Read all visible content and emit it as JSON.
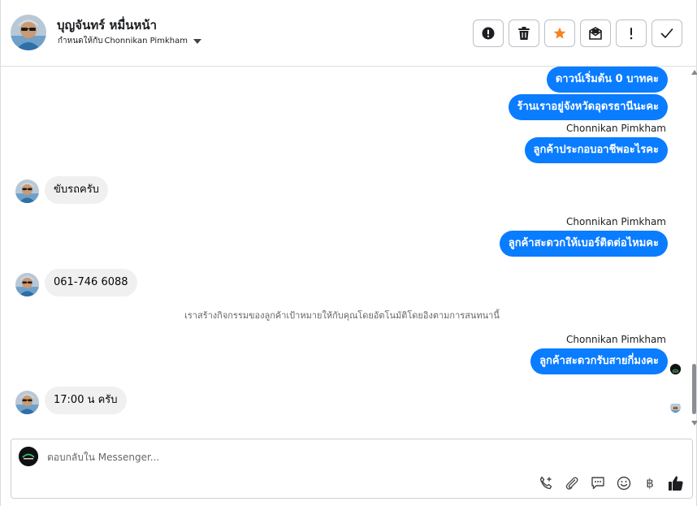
{
  "header": {
    "contact_name": "บุญจันทร์ หมื่นหน้า",
    "assigned_label": "กำหนดให้กับ",
    "assigned_to": "Chonnikan Pimkham",
    "action_icons": [
      "alert-circle-icon",
      "trash-icon",
      "star-icon",
      "mail-mark-icon",
      "exclamation-icon",
      "check-icon"
    ],
    "star_color": "#f5831f"
  },
  "messages": [
    {
      "direction": "out",
      "text": "ดาวน์เริ่มต้น 0 บาทคะ"
    },
    {
      "direction": "out",
      "text": "ร้านเราอยู่จังหวัดอุดรธานีนะคะ"
    },
    {
      "direction": "out",
      "sender": "Chonnikan Pimkham",
      "text": "ลูกค้าประกอบอาชีพอะไรคะ"
    },
    {
      "direction": "in",
      "text": "ขับรถครับ"
    },
    {
      "direction": "out",
      "sender": "Chonnikan Pimkham",
      "text": "ลูกค้าสะดวกให้เบอร์ติดต่อไหมคะ"
    },
    {
      "direction": "in",
      "text": "061-746 6088"
    },
    {
      "direction": "system",
      "text": "เราสร้างกิจกรรมของลูกค้าเป้าหมายให้กับคุณโดยอัตโนมัติโดยอิงตามการสนทนานี้"
    },
    {
      "direction": "out",
      "sender": "Chonnikan Pimkham",
      "text": "ลูกค้าสะดวกรับสายกี่มงคะ"
    },
    {
      "direction": "in",
      "text": "17:00 น ครับ"
    }
  ],
  "composer": {
    "placeholder": "ตอบกลับใน Messenger...",
    "tool_icons": [
      "call-add-icon",
      "paperclip-icon",
      "saved-reply-icon",
      "emoji-icon",
      "baht-icon",
      "thumbs-up-icon"
    ],
    "baht_symbol": "฿"
  },
  "colors": {
    "outgoing_bubble": "#0a7cff",
    "incoming_bubble": "#f0f0f0"
  }
}
